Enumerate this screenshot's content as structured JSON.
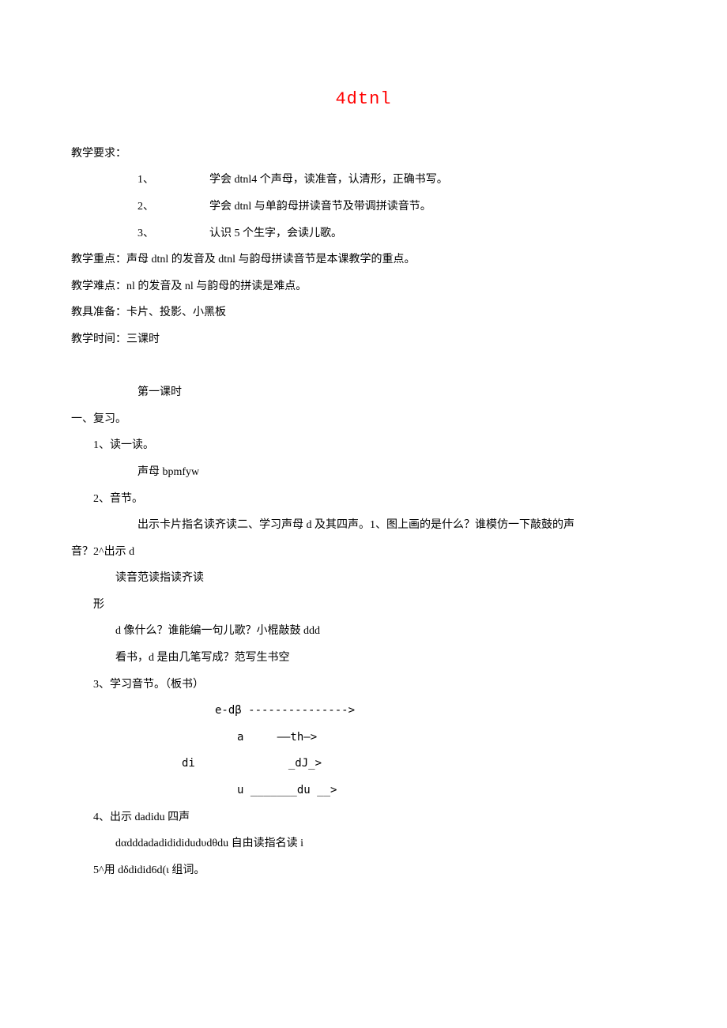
{
  "title": "4dtnl",
  "sections": {
    "requirements": {
      "heading": "教学要求：",
      "items": [
        {
          "num": "1、",
          "text": "学会 dtnl4 个声母，读准音，认清形，正确书写。"
        },
        {
          "num": "2、",
          "text": "学会 dtnl 与单韵母拼读音节及带调拼读音节。"
        },
        {
          "num": "3、",
          "text": "认识 5 个生字，会读儿歌。"
        }
      ]
    },
    "key": "教学重点：声母 dtnl 的发音及 dtnl 与韵母拼读音节是本课教学的重点。",
    "difficulty": "教学难点：nl 的发音及 nl 与韵母的拼读是难点。",
    "prep": "教具准备：卡片、投影、小黑板",
    "time": "教学时间：三课时",
    "lesson1": {
      "heading": "第一课时",
      "section1": {
        "heading": "一、复习。",
        "item1": {
          "label": "1、读一读。",
          "content": "声母 bpmfyw"
        },
        "item2": {
          "label": "2、音节。",
          "content": "出示卡片指名读齐读二、学习声母 d 及其四声。1、图上画的是什么？谁模仿一下敲鼓的声",
          "content2": "音？2^出示 d",
          "content3": "读音范读指读齐读"
        },
        "shape": {
          "label": "形",
          "line1": "d 像什么？谁能编一句儿歌？小棍敲鼓 ddd",
          "line2": "看书，d 是由几笔写成？范写生书空"
        },
        "item3": {
          "label": "3、学习音节。（板书）",
          "rows": [
            "e-dβ --------------->",
            "a     ——th—>",
            "di              _dJ_>",
            "u _______du __>"
          ]
        },
        "item4": {
          "label": "4、出示 dadidu 四声",
          "content": "dαdddadadidididudυdθdu 自由读指名读 i"
        },
        "item5": {
          "label": "5^用 dδdidid6d(ι 组词。"
        }
      }
    }
  }
}
